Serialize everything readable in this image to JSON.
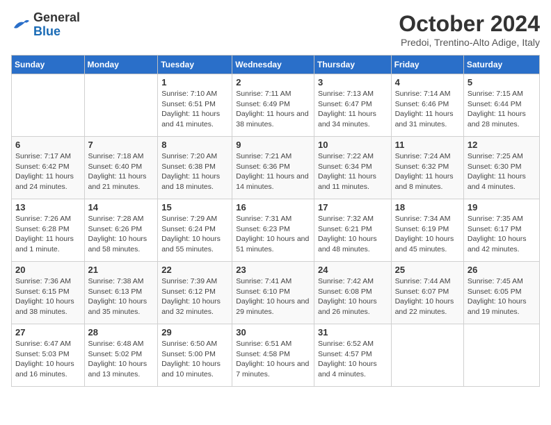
{
  "header": {
    "logo_line1": "General",
    "logo_line2": "Blue",
    "month": "October 2024",
    "location": "Predoi, Trentino-Alto Adige, Italy"
  },
  "weekdays": [
    "Sunday",
    "Monday",
    "Tuesday",
    "Wednesday",
    "Thursday",
    "Friday",
    "Saturday"
  ],
  "weeks": [
    [
      {
        "day": null
      },
      {
        "day": null
      },
      {
        "day": "1",
        "sunrise": "Sunrise: 7:10 AM",
        "sunset": "Sunset: 6:51 PM",
        "daylight": "Daylight: 11 hours and 41 minutes."
      },
      {
        "day": "2",
        "sunrise": "Sunrise: 7:11 AM",
        "sunset": "Sunset: 6:49 PM",
        "daylight": "Daylight: 11 hours and 38 minutes."
      },
      {
        "day": "3",
        "sunrise": "Sunrise: 7:13 AM",
        "sunset": "Sunset: 6:47 PM",
        "daylight": "Daylight: 11 hours and 34 minutes."
      },
      {
        "day": "4",
        "sunrise": "Sunrise: 7:14 AM",
        "sunset": "Sunset: 6:46 PM",
        "daylight": "Daylight: 11 hours and 31 minutes."
      },
      {
        "day": "5",
        "sunrise": "Sunrise: 7:15 AM",
        "sunset": "Sunset: 6:44 PM",
        "daylight": "Daylight: 11 hours and 28 minutes."
      }
    ],
    [
      {
        "day": "6",
        "sunrise": "Sunrise: 7:17 AM",
        "sunset": "Sunset: 6:42 PM",
        "daylight": "Daylight: 11 hours and 24 minutes."
      },
      {
        "day": "7",
        "sunrise": "Sunrise: 7:18 AM",
        "sunset": "Sunset: 6:40 PM",
        "daylight": "Daylight: 11 hours and 21 minutes."
      },
      {
        "day": "8",
        "sunrise": "Sunrise: 7:20 AM",
        "sunset": "Sunset: 6:38 PM",
        "daylight": "Daylight: 11 hours and 18 minutes."
      },
      {
        "day": "9",
        "sunrise": "Sunrise: 7:21 AM",
        "sunset": "Sunset: 6:36 PM",
        "daylight": "Daylight: 11 hours and 14 minutes."
      },
      {
        "day": "10",
        "sunrise": "Sunrise: 7:22 AM",
        "sunset": "Sunset: 6:34 PM",
        "daylight": "Daylight: 11 hours and 11 minutes."
      },
      {
        "day": "11",
        "sunrise": "Sunrise: 7:24 AM",
        "sunset": "Sunset: 6:32 PM",
        "daylight": "Daylight: 11 hours and 8 minutes."
      },
      {
        "day": "12",
        "sunrise": "Sunrise: 7:25 AM",
        "sunset": "Sunset: 6:30 PM",
        "daylight": "Daylight: 11 hours and 4 minutes."
      }
    ],
    [
      {
        "day": "13",
        "sunrise": "Sunrise: 7:26 AM",
        "sunset": "Sunset: 6:28 PM",
        "daylight": "Daylight: 11 hours and 1 minute."
      },
      {
        "day": "14",
        "sunrise": "Sunrise: 7:28 AM",
        "sunset": "Sunset: 6:26 PM",
        "daylight": "Daylight: 10 hours and 58 minutes."
      },
      {
        "day": "15",
        "sunrise": "Sunrise: 7:29 AM",
        "sunset": "Sunset: 6:24 PM",
        "daylight": "Daylight: 10 hours and 55 minutes."
      },
      {
        "day": "16",
        "sunrise": "Sunrise: 7:31 AM",
        "sunset": "Sunset: 6:23 PM",
        "daylight": "Daylight: 10 hours and 51 minutes."
      },
      {
        "day": "17",
        "sunrise": "Sunrise: 7:32 AM",
        "sunset": "Sunset: 6:21 PM",
        "daylight": "Daylight: 10 hours and 48 minutes."
      },
      {
        "day": "18",
        "sunrise": "Sunrise: 7:34 AM",
        "sunset": "Sunset: 6:19 PM",
        "daylight": "Daylight: 10 hours and 45 minutes."
      },
      {
        "day": "19",
        "sunrise": "Sunrise: 7:35 AM",
        "sunset": "Sunset: 6:17 PM",
        "daylight": "Daylight: 10 hours and 42 minutes."
      }
    ],
    [
      {
        "day": "20",
        "sunrise": "Sunrise: 7:36 AM",
        "sunset": "Sunset: 6:15 PM",
        "daylight": "Daylight: 10 hours and 38 minutes."
      },
      {
        "day": "21",
        "sunrise": "Sunrise: 7:38 AM",
        "sunset": "Sunset: 6:13 PM",
        "daylight": "Daylight: 10 hours and 35 minutes."
      },
      {
        "day": "22",
        "sunrise": "Sunrise: 7:39 AM",
        "sunset": "Sunset: 6:12 PM",
        "daylight": "Daylight: 10 hours and 32 minutes."
      },
      {
        "day": "23",
        "sunrise": "Sunrise: 7:41 AM",
        "sunset": "Sunset: 6:10 PM",
        "daylight": "Daylight: 10 hours and 29 minutes."
      },
      {
        "day": "24",
        "sunrise": "Sunrise: 7:42 AM",
        "sunset": "Sunset: 6:08 PM",
        "daylight": "Daylight: 10 hours and 26 minutes."
      },
      {
        "day": "25",
        "sunrise": "Sunrise: 7:44 AM",
        "sunset": "Sunset: 6:07 PM",
        "daylight": "Daylight: 10 hours and 22 minutes."
      },
      {
        "day": "26",
        "sunrise": "Sunrise: 7:45 AM",
        "sunset": "Sunset: 6:05 PM",
        "daylight": "Daylight: 10 hours and 19 minutes."
      }
    ],
    [
      {
        "day": "27",
        "sunrise": "Sunrise: 6:47 AM",
        "sunset": "Sunset: 5:03 PM",
        "daylight": "Daylight: 10 hours and 16 minutes."
      },
      {
        "day": "28",
        "sunrise": "Sunrise: 6:48 AM",
        "sunset": "Sunset: 5:02 PM",
        "daylight": "Daylight: 10 hours and 13 minutes."
      },
      {
        "day": "29",
        "sunrise": "Sunrise: 6:50 AM",
        "sunset": "Sunset: 5:00 PM",
        "daylight": "Daylight: 10 hours and 10 minutes."
      },
      {
        "day": "30",
        "sunrise": "Sunrise: 6:51 AM",
        "sunset": "Sunset: 4:58 PM",
        "daylight": "Daylight: 10 hours and 7 minutes."
      },
      {
        "day": "31",
        "sunrise": "Sunrise: 6:52 AM",
        "sunset": "Sunset: 4:57 PM",
        "daylight": "Daylight: 10 hours and 4 minutes."
      },
      {
        "day": null
      },
      {
        "day": null
      }
    ]
  ]
}
